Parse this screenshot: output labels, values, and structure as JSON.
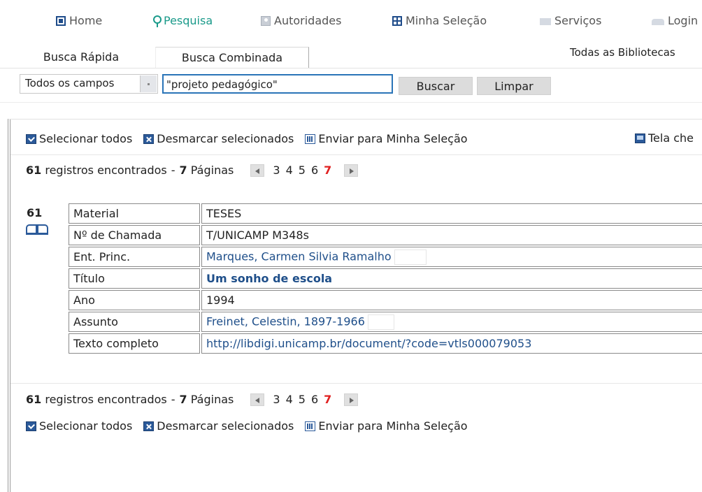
{
  "nav": {
    "home": "Home",
    "pesquisa": "Pesquisa",
    "autoridades": "Autoridades",
    "minha_selecao": "Minha Seleção",
    "servicos": "Serviços",
    "login": "Login",
    "active": "pesquisa",
    "active_color": "#1a9a8a"
  },
  "tabs": {
    "rapida": "Busca Rápida",
    "combinada": "Busca Combinada",
    "libraries": "Todas as Bibliotecas"
  },
  "search": {
    "field_selected": "Todos os campos",
    "query": "\"projeto pedagógico\"",
    "buscar_label": "Buscar",
    "limpar_label": "Limpar"
  },
  "toolbar": {
    "select_all": "Selecionar todos",
    "deselect": "Desmarcar selecionados",
    "send": "Enviar para Minha Seleção",
    "fullscreen": "Tela che"
  },
  "pager": {
    "count": "61",
    "count_text": "registros encontrados",
    "dash": "-",
    "pages": "7",
    "pages_text": "Páginas",
    "page_numbers": [
      "3",
      "4",
      "5",
      "6",
      "7"
    ],
    "current_page": "7"
  },
  "record": {
    "index": "61",
    "material_label": "Material",
    "material": "TESES",
    "chamada_label": "Nº de Chamada",
    "chamada": "T/UNICAMP M348s",
    "autor_label": "Ent. Princ.",
    "autor": "Marques, Carmen Silvia Ramalho",
    "titulo_label": "Título",
    "titulo": "Um sonho de escola",
    "ano_label": "Ano",
    "ano": "1994",
    "assunto_label": "Assunto",
    "assunto": "Freinet, Celestin, 1897-1966",
    "texto_label": "Texto completo",
    "texto": "http://libdigi.unicamp.br/document/?code=vtls000079053"
  }
}
